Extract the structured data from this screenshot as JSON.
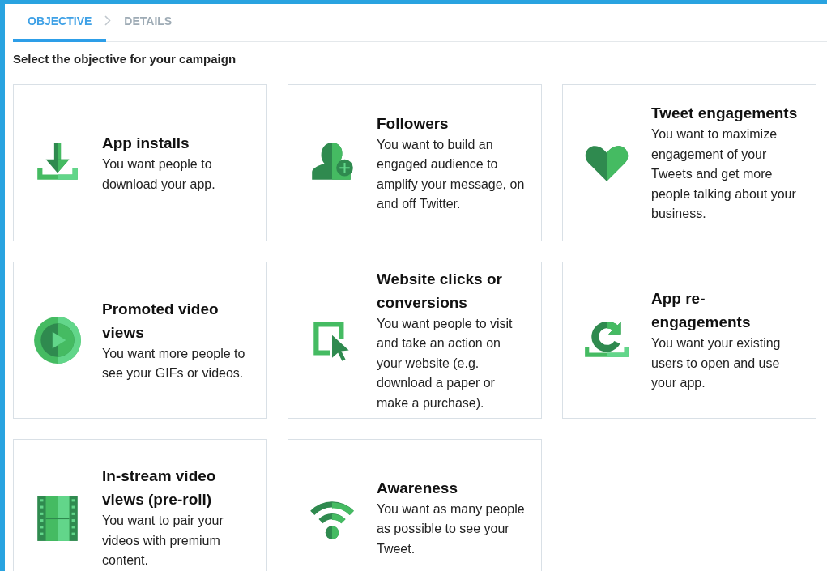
{
  "tabs": [
    {
      "label": "OBJECTIVE",
      "selected": true
    },
    {
      "label": "DETAILS",
      "selected": false
    }
  ],
  "heading": "Select the objective for your campaign",
  "objectives": [
    {
      "kind": "download",
      "title": "App installs",
      "description": "You want people to download your app."
    },
    {
      "kind": "follower",
      "title": "Followers",
      "description": "You want to build an engaged audience to amplify your message, on and off Twitter."
    },
    {
      "kind": "heart",
      "title": "Tweet engagements",
      "description": "You want to maximize engagement of your Tweets and get more people talking about your business."
    },
    {
      "kind": "play",
      "title": "Promoted video views",
      "description": "You want more people to see your GIFs or videos."
    },
    {
      "kind": "click",
      "title": "Website clicks or conversions",
      "description": "You want people to visit and take an action on your website (e.g. download a paper or make a purchase)."
    },
    {
      "kind": "refresh",
      "title": "App re-engagements",
      "description": "You want your existing users to open and use your app."
    },
    {
      "kind": "film",
      "title": "In-stream video views (pre-roll)",
      "description": "You want to pair your videos with premium content."
    },
    {
      "kind": "signal",
      "title": "Awareness",
      "description": "You want as many people as possible to see your Tweet."
    }
  ]
}
